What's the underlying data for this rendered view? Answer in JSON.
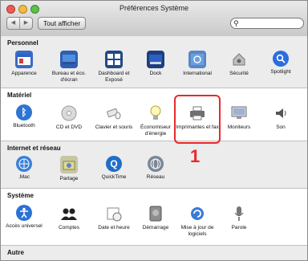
{
  "window": {
    "title": "Préférences Système",
    "nav_back": "◀",
    "nav_forward": "▶",
    "show_all": "Tout afficher",
    "search_value": "",
    "search_placeholder": ""
  },
  "sections": {
    "personnel": {
      "title": "Personnel",
      "items": [
        "Apparence",
        "Bureau et éco. d'écran",
        "Dashboard et Exposé",
        "Dock",
        "International",
        "Sécurité",
        "Spotlight"
      ]
    },
    "materiel": {
      "title": "Matériel",
      "items": [
        "Bluetooth",
        "CD et DVD",
        "Clavier et souris",
        "Économiseur d'énergie",
        "Imprimantes et fax",
        "Moniteurs",
        "Son"
      ]
    },
    "internet": {
      "title": "Internet et réseau",
      "items": [
        ".Mac",
        "Partage",
        "QuickTime",
        "Réseau"
      ]
    },
    "systeme": {
      "title": "Système",
      "items": [
        "Accès universel",
        "Comptes",
        "Date et heure",
        "Démarrage",
        "Mise à jour de logiciels",
        "Parole"
      ]
    },
    "autre": {
      "title": "Autre"
    }
  },
  "annotation": {
    "callout": "1",
    "color": "#e8292b"
  },
  "icons": {
    "apparence": "appearance-icon",
    "bureau": "desktop-icon",
    "dashboard": "dashboard-icon",
    "dock": "dock-icon",
    "international": "globe-flag-icon",
    "securite": "house-lock-icon",
    "spotlight": "spotlight-icon",
    "bluetooth": "bluetooth-icon",
    "cd": "cd-icon",
    "clavier": "keyboard-mouse-icon",
    "economiseur": "lightbulb-icon",
    "imprimantes": "printer-icon",
    "moniteurs": "monitor-icon",
    "son": "speaker-icon",
    "mac": "mac-globe-icon",
    "partage": "sharing-folder-icon",
    "quicktime": "quicktime-icon",
    "reseau": "network-globe-icon",
    "acces": "accessibility-icon",
    "comptes": "accounts-icon",
    "date": "calendar-clock-icon",
    "demarrage": "disk-icon",
    "maj": "software-update-icon",
    "parole": "microphone-icon"
  }
}
